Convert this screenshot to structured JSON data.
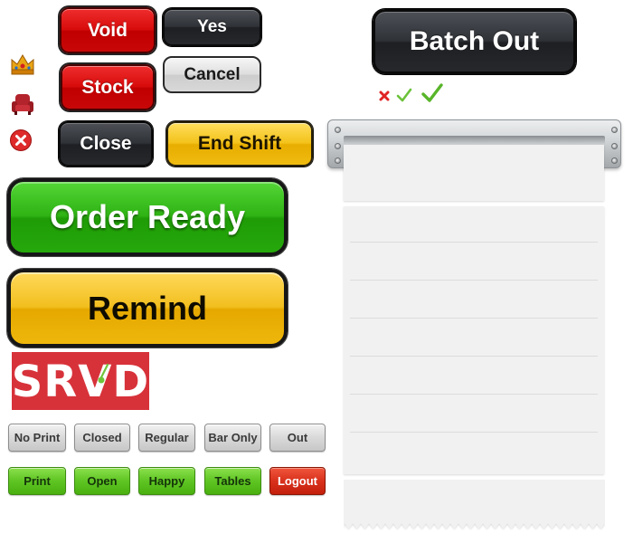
{
  "buttons": {
    "void": "Void",
    "yes": "Yes",
    "stock": "Stock",
    "cancel": "Cancel",
    "close": "Close",
    "end_shift": "End Shift",
    "batch_out": "Batch Out",
    "order_ready": "Order Ready",
    "remind": "Remind"
  },
  "logo": {
    "text": "SRVD"
  },
  "filter_row_1": [
    "No Print",
    "Closed",
    "Regular",
    "Bar Only",
    "Out"
  ],
  "filter_row_2": [
    "Print",
    "Open",
    "Happy",
    "Tables",
    "Logout"
  ],
  "icons": {
    "left_column": [
      "crown-icon",
      "armchair-icon",
      "red-x-circle-icon"
    ],
    "status_row": [
      "x-mark-icon",
      "check-mark-small-icon",
      "check-mark-large-icon"
    ]
  },
  "colors": {
    "red": "#d80b0b",
    "dark": "#2f3237",
    "silver": "#dedede",
    "yellow": "#f3c21a",
    "green": "#2fb314",
    "logo_bg": "#d7323a",
    "filter_green": "#5fc523",
    "filter_red": "#d9311c"
  }
}
